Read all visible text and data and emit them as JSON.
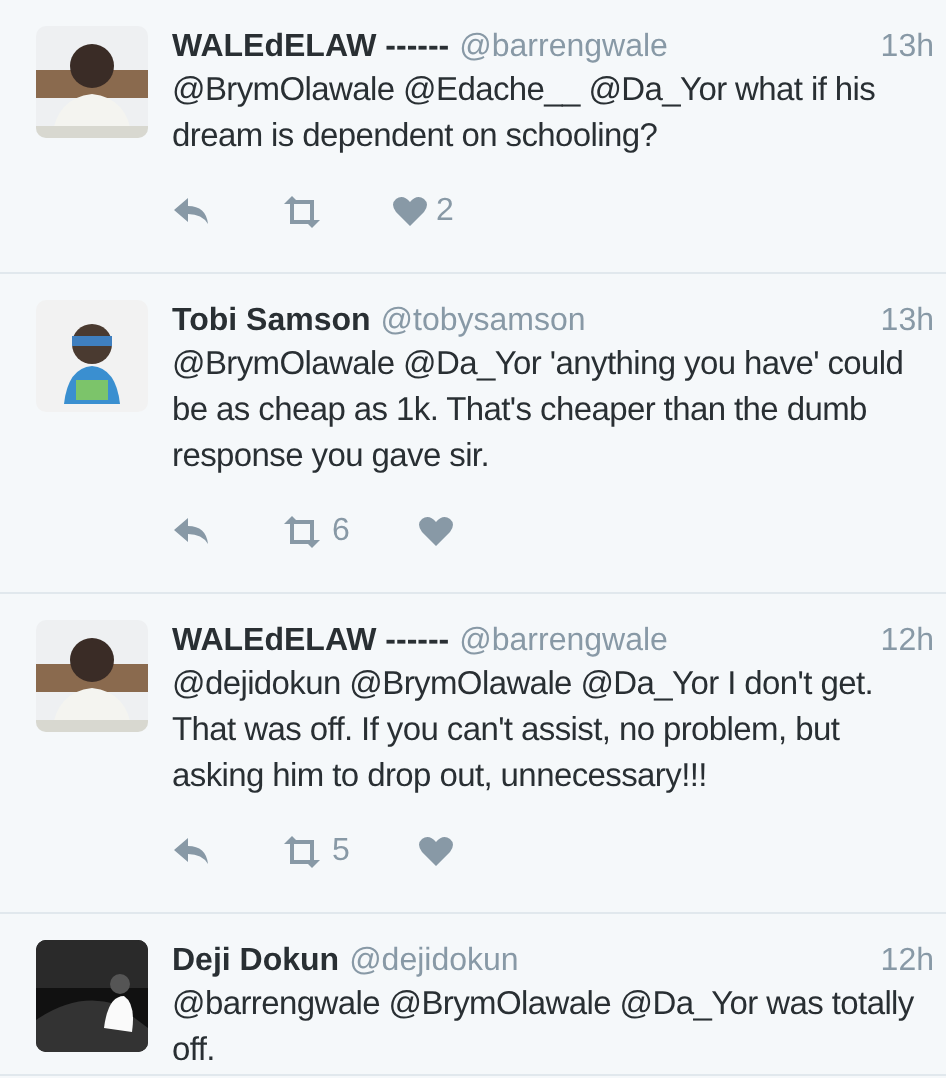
{
  "tweets": [
    {
      "name": "WALEdELAW ------",
      "handle": "@barrengwale",
      "time": "13h",
      "text": "@BrymOlawale @Edache__ @Da_Yor what if his dream is dependent on schooling?",
      "actions": [
        {
          "kind": "reply"
        },
        {
          "kind": "retweet"
        },
        {
          "kind": "like",
          "count": "2"
        }
      ]
    },
    {
      "name": "Tobi Samson",
      "handle": "@tobysamson",
      "time": "13h",
      "text": "@BrymOlawale @Da_Yor 'anything you have' could be as cheap as 1k. That's cheaper than the dumb response you gave sir.",
      "actions": [
        {
          "kind": "reply"
        },
        {
          "kind": "retweet",
          "count": "6"
        },
        {
          "kind": "like"
        }
      ]
    },
    {
      "name": "WALEdELAW ------",
      "handle": "@barrengwale",
      "time": "12h",
      "text": "@dejidokun @BrymOlawale @Da_Yor I don't get. That was off. If you can't assist, no problem, but asking him to drop out, unnecessary!!!",
      "actions": [
        {
          "kind": "reply"
        },
        {
          "kind": "retweet",
          "count": "5"
        },
        {
          "kind": "like"
        }
      ]
    },
    {
      "name": "Deji Dokun",
      "handle": "@dejidokun",
      "time": "12h",
      "text": "@barrengwale @BrymOlawale @Da_Yor was totally off."
    }
  ]
}
